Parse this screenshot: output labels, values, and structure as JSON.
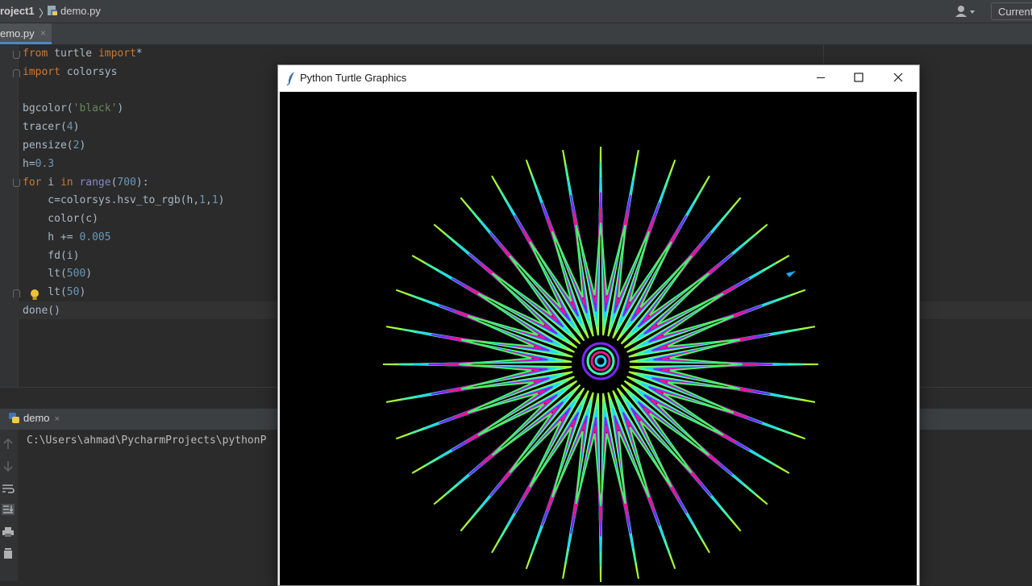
{
  "navbar": {
    "project": "roject1",
    "separator": "〉",
    "file": "demo.py",
    "run_config": "Current"
  },
  "tabs": [
    {
      "label": "emo.py",
      "close": "×"
    }
  ],
  "code": {
    "lines": [
      "from turtle import*",
      "import colorsys",
      "",
      "bgcolor('black')",
      "tracer(4)",
      "pensize(2)",
      "h=0.3",
      "for i in range(700):",
      "    c=colorsys.hsv_to_rgb(h,1,1)",
      "    color(c)",
      "    h += 0.005",
      "    fd(i)",
      "    lt(500)",
      "    lt(50)",
      "done()"
    ]
  },
  "run": {
    "tab_label": "demo",
    "tab_close": "×",
    "console_text": "C:\\Users\\ahmad\\PycharmProjects\\pythonP"
  },
  "turtle_window": {
    "title": "Python Turtle Graphics",
    "background": "#000000"
  },
  "colors": {
    "ide_bg": "#2b2b2b",
    "keyword": "#cc7832",
    "string": "#6a8759",
    "number": "#6897bb",
    "accent": "#4a88c7"
  },
  "icons": [
    "python-file-icon",
    "user-icon",
    "fold-icon",
    "bulb-icon",
    "python-icon",
    "arrow-up-icon",
    "arrow-down-icon",
    "soft-wrap-icon",
    "scroll-end-icon",
    "print-icon",
    "trash-icon",
    "feather-icon",
    "minimize-icon",
    "maximize-icon",
    "close-icon",
    "turtle-cursor-icon"
  ]
}
